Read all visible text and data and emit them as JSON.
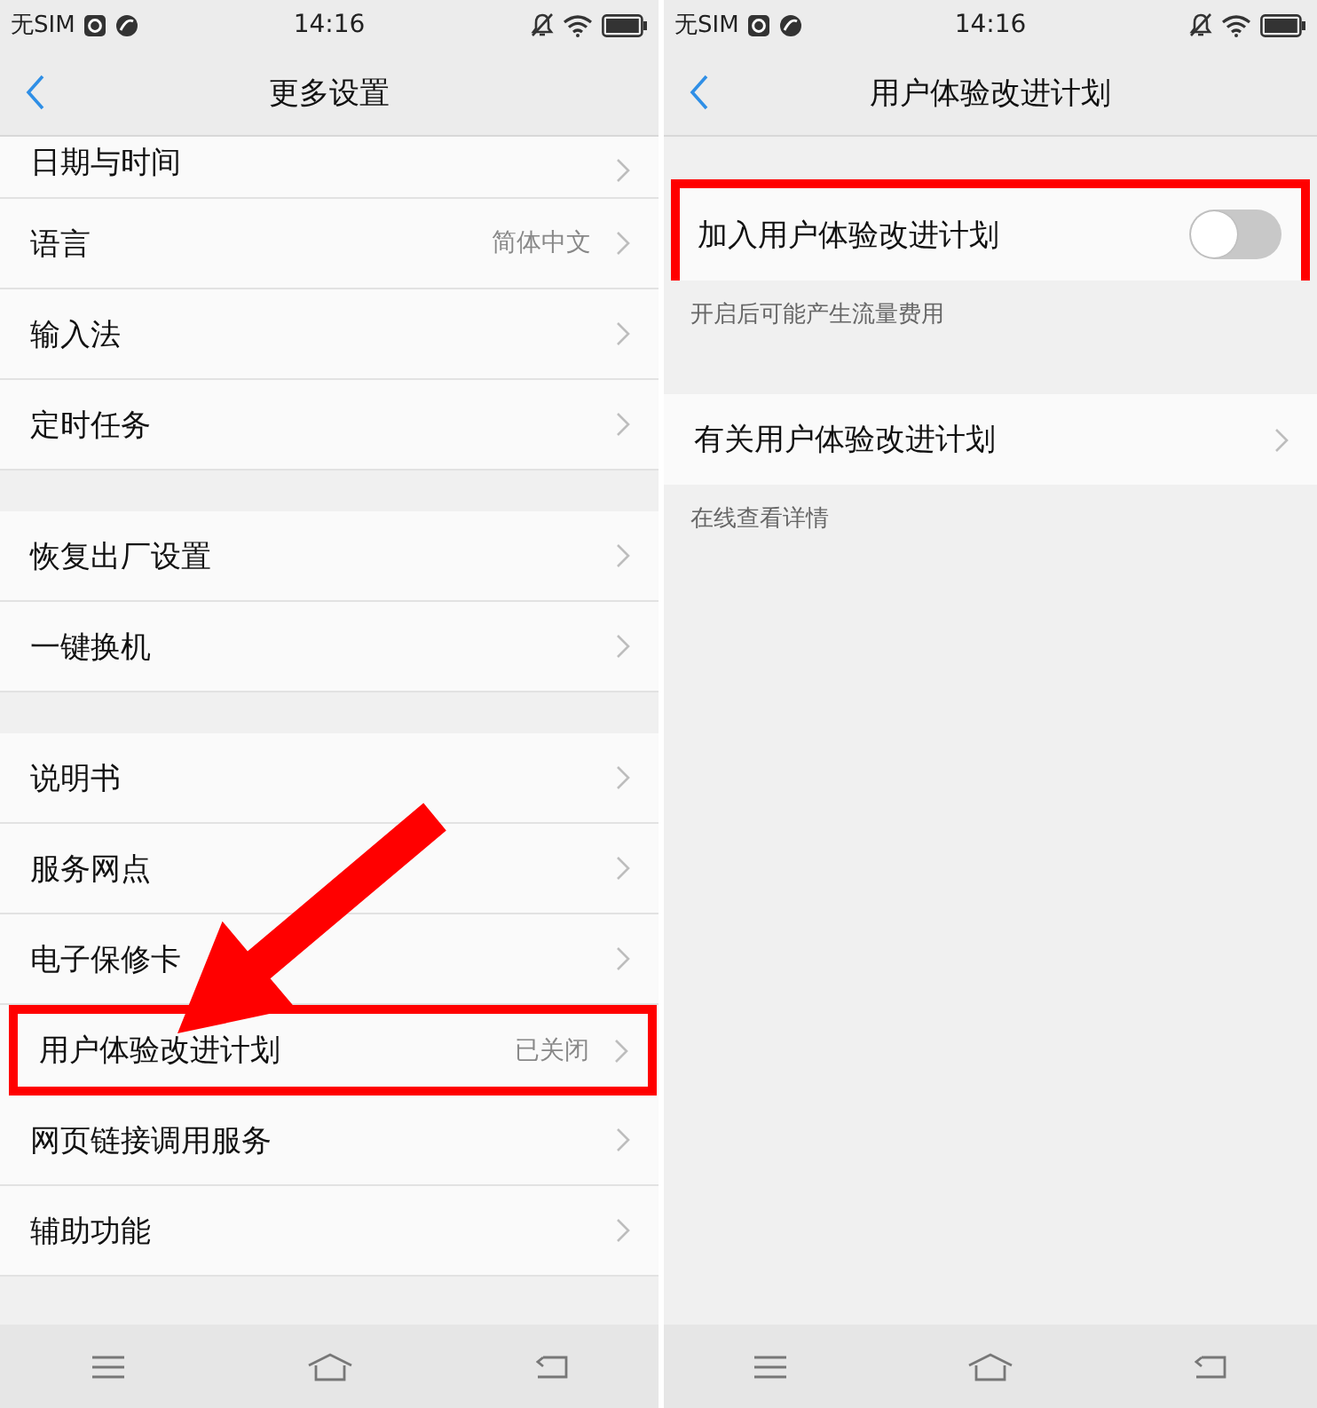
{
  "screens": [
    {
      "status_bar": {
        "carrier": "无SIM",
        "time": "14:16"
      },
      "title": "更多设置",
      "pointer_arrow": true,
      "groups": [
        [
          {
            "label": "日期与时间",
            "highlighted": false
          },
          {
            "label": "语言",
            "value": "简体中文",
            "highlighted": false
          },
          {
            "label": "输入法",
            "highlighted": false
          },
          {
            "label": "定时任务",
            "highlighted": false
          }
        ],
        [
          {
            "label": "恢复出厂设置",
            "highlighted": false
          },
          {
            "label": "一键换机",
            "highlighted": false
          }
        ],
        [
          {
            "label": "说明书",
            "highlighted": false
          },
          {
            "label": "服务网点",
            "highlighted": false
          },
          {
            "label": "电子保修卡",
            "highlighted": false
          },
          {
            "label": "用户体验改进计划",
            "value": "已关闭",
            "highlighted": true
          },
          {
            "label": "网页链接调用服务",
            "highlighted": false
          },
          {
            "label": "辅助功能",
            "highlighted": false
          }
        ]
      ]
    },
    {
      "status_bar": {
        "carrier": "无SIM",
        "time": "14:16"
      },
      "title": "用户体验改进计划",
      "pointer_arrow": false,
      "sections": [
        {
          "kind": "toggle",
          "label": "加入用户体验改进计划",
          "on": false,
          "highlighted": true,
          "caption": "开启后可能产生流量费用"
        },
        {
          "kind": "link",
          "label": "有关用户体验改进计划",
          "highlighted": false,
          "caption": "在线查看详情"
        }
      ]
    }
  ]
}
